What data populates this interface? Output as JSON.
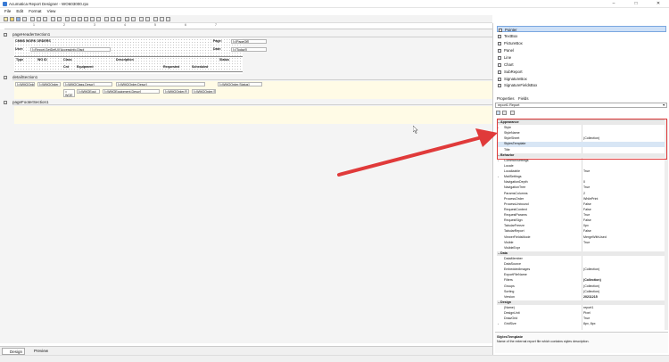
{
  "window": {
    "title": "Acumatica Report Designer - WO603000.rpx",
    "controls": [
      "–",
      "□",
      "✕"
    ]
  },
  "menu": [
    "File",
    "Edit",
    "Format",
    "View"
  ],
  "ruler_ticks": [
    "1",
    "2",
    "3",
    "4",
    "5",
    "6",
    "7"
  ],
  "sections": {
    "header": "pageHeaderSection1",
    "detail": "detailSection1",
    "footer": "pageFooterSection1"
  },
  "report_header": {
    "title": "CMMS WORK ORDERS",
    "page_label": "Page:",
    "page_value": "[=[PageOf]]",
    "user_label": "User:",
    "user_value": "[=Report.GetDefUI('AccessInfo.Displ",
    "date_label": "Date:",
    "date_value": "[=[Today]]",
    "columns_row1": [
      "Type",
      "WO ID",
      "Class",
      "Description",
      "Status"
    ],
    "columns_row2": [
      "Cnt",
      "Equipment",
      "Requested",
      "Scheduled"
    ]
  },
  "detail_fields": {
    "row1": [
      "[=WMOOrder",
      "[=WMOOrder",
      "[=WMOClass.Descr]",
      "[=WMOOrder.Descr]",
      "[=WMOOrder.Status]"
    ],
    "row2": [
      "=\nWOE",
      "[=WMOEqui",
      "[=WMOEquipment.Descr]",
      "[=WMOOrder.R",
      "[=WMOOrder.S"
    ]
  },
  "toolbox": {
    "items": [
      "Pointer",
      "TextBox",
      "PictureBox",
      "Panel",
      "Line",
      "Chart",
      "SubReport",
      "SignatureBox",
      "SignatureFieldsBox"
    ]
  },
  "properties": {
    "tabs": [
      "Properties",
      "Fields"
    ],
    "object": "report1  Report",
    "rows": [
      {
        "name": "Appearance",
        "value": "",
        "cat": true
      },
      {
        "name": "Style",
        "value": "",
        "exp": true
      },
      {
        "name": "StyleName",
        "value": ""
      },
      {
        "name": "StyleSheet",
        "value": "(Collection)"
      },
      {
        "name": "StylesTemplate",
        "value": "",
        "sel": true
      },
      {
        "name": "Title",
        "value": ""
      },
      {
        "name": "Behavior",
        "value": "",
        "cat": true
      },
      {
        "name": "CommonSettings",
        "value": "",
        "exp": true
      },
      {
        "name": "Locale",
        "value": ""
      },
      {
        "name": "Localizable",
        "value": "True"
      },
      {
        "name": "MailSettings",
        "value": "",
        "exp": true
      },
      {
        "name": "NavigationDepth",
        "value": "0"
      },
      {
        "name": "NavigationTree",
        "value": "True"
      },
      {
        "name": "ParamsColumns",
        "value": "2"
      },
      {
        "name": "ProcessOrder",
        "value": "WhilePrint"
      },
      {
        "name": "ProcessUnbound",
        "value": "False"
      },
      {
        "name": "RequestContext",
        "value": "False"
      },
      {
        "name": "RequestParams",
        "value": "True"
      },
      {
        "name": "RequestSign",
        "value": "False"
      },
      {
        "name": "TabularFreeze",
        "value": "0px"
      },
      {
        "name": "TabularReport",
        "value": "False"
      },
      {
        "name": "ViewerFieldsMode",
        "value": "MergeWithUsed"
      },
      {
        "name": "Visible",
        "value": "True"
      },
      {
        "name": "VisibleExpr",
        "value": ""
      },
      {
        "name": "Data",
        "value": "",
        "cat": true
      },
      {
        "name": "DataMember",
        "value": ""
      },
      {
        "name": "DataSource",
        "value": ""
      },
      {
        "name": "EmbeddedImages",
        "value": "(Collection)"
      },
      {
        "name": "ExportFileName",
        "value": ""
      },
      {
        "name": "Filters",
        "value": "(Collection)",
        "bold": true
      },
      {
        "name": "Groups",
        "value": "(Collection)"
      },
      {
        "name": "Sorting",
        "value": "(Collection)"
      },
      {
        "name": "Version",
        "value": "20211215",
        "bold": true
      },
      {
        "name": "Design",
        "value": "",
        "cat": true
      },
      {
        "name": "(Name)",
        "value": "report1"
      },
      {
        "name": "DesignUnit",
        "value": "Pixel"
      },
      {
        "name": "DrawGrid",
        "value": "True"
      },
      {
        "name": "GridSize",
        "value": "8px, 8px",
        "exp": true
      }
    ],
    "help_title": "StylesTemplate",
    "help_text": "Name of the external report file which contains styles description."
  },
  "bottom_tabs": [
    "Design",
    "Preview"
  ],
  "colors": {
    "arrow": "#e03a3a",
    "highlight_box": "#e03a3a",
    "selected_tool": "#cde0f7",
    "yellow_band": "#fffbe6"
  }
}
